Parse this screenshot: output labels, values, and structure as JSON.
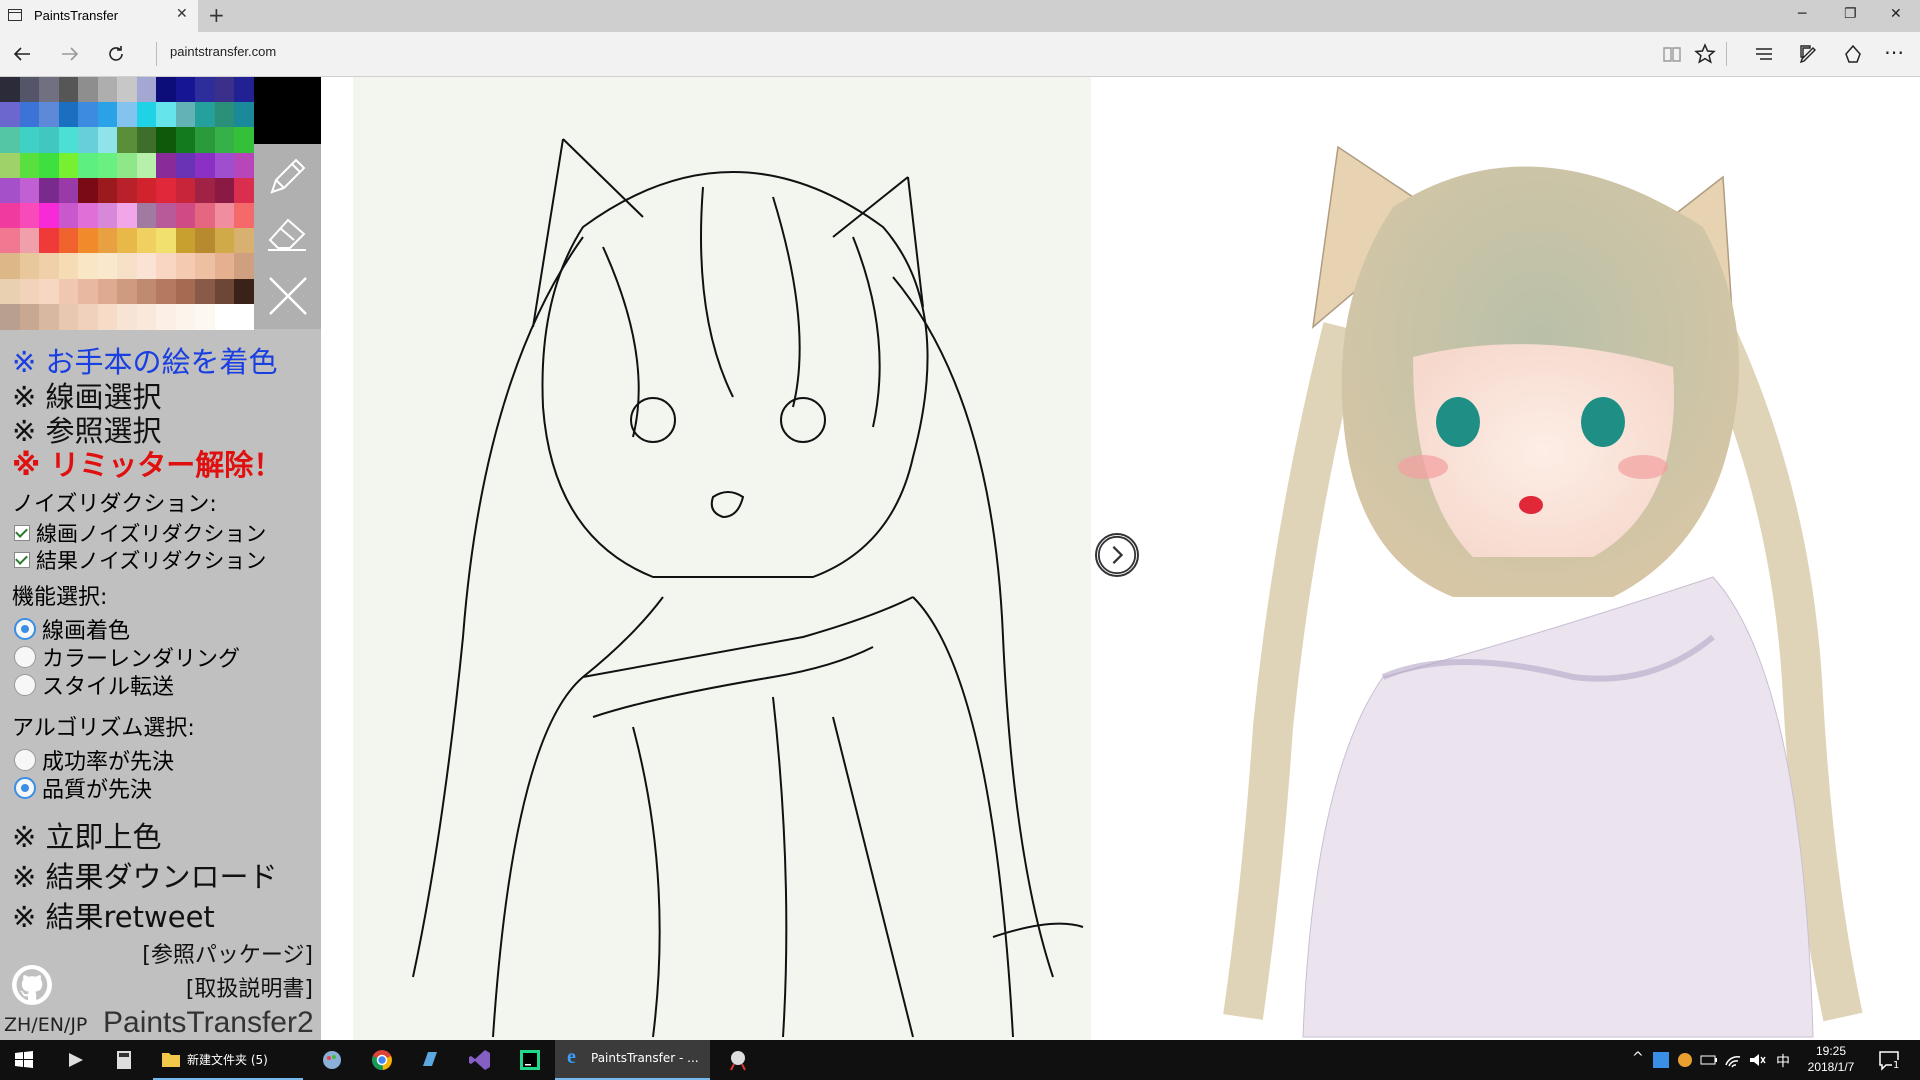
{
  "browser": {
    "tab_title": "PaintsTransfer",
    "tab_close": "✕",
    "new_tab": "+",
    "url": "paintstransfer.com",
    "win_min": "─",
    "win_restore": "❐",
    "win_close": "✕"
  },
  "panel": {
    "colors": [
      [
        "#2b2b3a",
        "#55556a",
        "#707080",
        "#565656",
        "#8e8e8e",
        "#aeaeae",
        "#c7c7c7",
        "#a3a7d1",
        "#0d0d7a",
        "#161694",
        "#2d2d9c",
        "#3a2f8a",
        "#212194"
      ],
      [
        "#6c66cf",
        "#3b74d6",
        "#5e88d8",
        "#1b6fc0",
        "#3d8be0",
        "#2aa2e8",
        "#82c4ef",
        "#1fd2e6",
        "#65e4ec",
        "#63b2b5",
        "#25a09d",
        "#2a907a",
        "#1a8a9a"
      ],
      [
        "#54c6a6",
        "#3fd1c5",
        "#40c8c0",
        "#4be0d6",
        "#66cfd8",
        "#8ee4ea",
        "#5a8e38",
        "#3f6d2b",
        "#0c5a0a",
        "#137a1d",
        "#2a9a3a",
        "#36b048",
        "#35c03a"
      ],
      [
        "#9fd36a",
        "#58e03f",
        "#3ee03f",
        "#76f030",
        "#5ef07e",
        "#6af080",
        "#8ee88a",
        "#b6f0aa",
        "#8a2b9a",
        "#6a33b5",
        "#8a30c4",
        "#a04ed0",
        "#b646ba"
      ],
      [
        "#a54fc8",
        "#c060d2",
        "#7a2a8c",
        "#9a3aa8",
        "#7a0a14",
        "#9a1a1e",
        "#b8202a",
        "#d0232e",
        "#e0283a",
        "#c8243a",
        "#a02244",
        "#8a1a44",
        "#da2e4e"
      ],
      [
        "#f03aa0",
        "#f84ab8",
        "#f82ad8",
        "#c858cc",
        "#e070d8",
        "#d888d8",
        "#f0a6e8",
        "#a07aa0",
        "#b85a9a",
        "#d04a86",
        "#e56680",
        "#f08ea0",
        "#f46a6a"
      ],
      [
        "#f07890",
        "#f0a0aa",
        "#f03a3a",
        "#f0622e",
        "#f08a2a",
        "#e8a040",
        "#e8b848",
        "#f0d060",
        "#f2e06e",
        "#c8a030",
        "#b88a30",
        "#d0aa48",
        "#d8b070"
      ],
      [
        "#dcb888",
        "#e8c89a",
        "#f0d0a8",
        "#f6dcb4",
        "#f8e6c4",
        "#fae8cc",
        "#f6e0c8",
        "#fae2d4",
        "#f8d6c2",
        "#f4cab0",
        "#eec0a2",
        "#e4b090",
        "#cfa080"
      ],
      [
        "#e8d0b0",
        "#f2d2b8",
        "#f6d8c2",
        "#f0c8b2",
        "#e8b8a0",
        "#deaa90",
        "#d09a80",
        "#c08a70",
        "#b47a60",
        "#a46a52",
        "#8a5a48",
        "#6e4638",
        "#3a2218"
      ],
      [
        "#b8a090",
        "#c8a890",
        "#d8b8a0",
        "#e8c8b0",
        "#f0d2bc",
        "#f6dcc8",
        "#f8e4d4",
        "#fae8da",
        "#fcf0e6",
        "#fdf4ec",
        "#fef8f2",
        "#ffffff",
        "#ffffff"
      ]
    ],
    "menu_colorize": "※ お手本の絵を着色",
    "menu_lineart": "※ 線画選択",
    "menu_reference": "※ 参照選択",
    "menu_limiter": "※ リミッター解除！",
    "noise_heading": "ノイズリダクション:",
    "noise_line": "線画ノイズリダクション",
    "noise_result": "結果ノイズリダクション",
    "function_heading": "機能選択:",
    "func_colorize": "線画着色",
    "func_render": "カラーレンダリング",
    "func_style": "スタイル転送",
    "algo_heading": "アルゴリズム選択:",
    "algo_success": "成功率が先決",
    "algo_quality": "品質が先決",
    "action_colorize": "※ 立即上色",
    "action_download": "※ 結果ダウンロード",
    "action_retweet": "※ 結果retweet",
    "link_package": "[参照パッケージ]",
    "link_manual": "[取扱説明書]",
    "lang": "ZH/EN/JP",
    "brand": "PaintsTransfer2"
  },
  "colors": {
    "link_blue": "#1a3fe0",
    "limiter_red": "#e01010",
    "accent": "#3a8ee6"
  },
  "taskbar": {
    "folder_label": "新建文件夹 (5)",
    "browser_label": "PaintsTransfer - ...",
    "ime": "中",
    "time": "19:25",
    "date": "2018/1/7",
    "notif_count": "1"
  }
}
